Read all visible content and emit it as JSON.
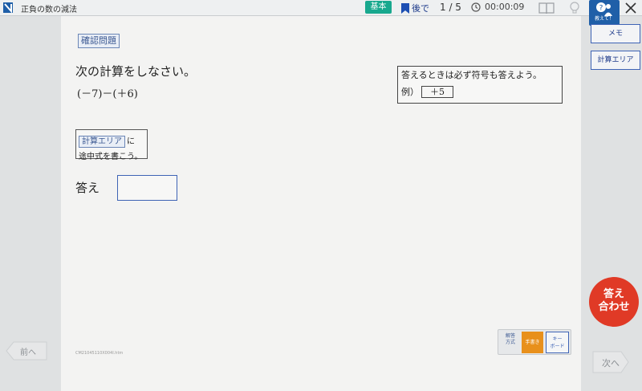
{
  "header": {
    "unit_title": "正負の数の減法",
    "level_badge": "基本",
    "later_label": "後で",
    "progress": "1 / 5",
    "timer": "00:00:09",
    "help_label": "教えて！"
  },
  "problem": {
    "section_label": "確認問題",
    "instruction": "次の計算をしなさい。",
    "expression": "(－7)－(＋6)",
    "hint_tag": "計算エリア",
    "hint_particle": "に",
    "hint_line2": "途中式を書こう。",
    "answer_label": "答え",
    "answer_value": "",
    "sign_note": "答えるときは必ず符号も答えよう。",
    "example_label": "例）",
    "example_value": "＋5",
    "problem_code": "CM21045110X004I.htm"
  },
  "answer_mode": {
    "label": "解答方式",
    "handwriting": "手書き",
    "keyboard": "キーボード",
    "selected": "手書き"
  },
  "nav": {
    "prev": "前へ",
    "next": "次へ"
  },
  "side": {
    "memo": "メモ",
    "calc_area": "計算エリア",
    "check_answer_line1": "答え",
    "check_answer_line2": "合わせ"
  },
  "colors": {
    "level_badge": "#18a88e",
    "accent_blue": "#3e63b5",
    "check_button": "#e03a26",
    "handwriting_mode": "#e8901c"
  }
}
